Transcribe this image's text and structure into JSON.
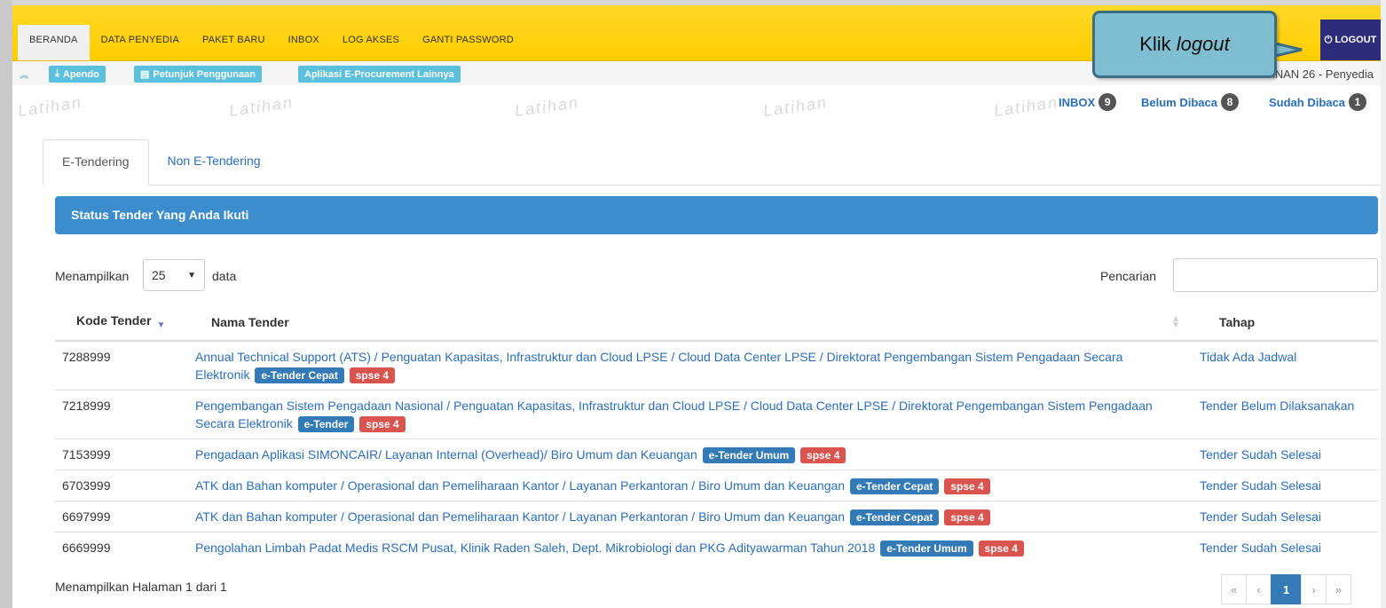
{
  "nav": {
    "items": [
      "BERANDA",
      "DATA PENYEDIA",
      "PAKET BARU",
      "INBOX",
      "LOG AKSES",
      "GANTI PASSWORD"
    ],
    "logout_label": "LOGOUT"
  },
  "callout": {
    "prefix": "Klik ",
    "emphasis": "logout"
  },
  "toolbar": {
    "apendo": "Apendo",
    "petunjuk": "Petunjuk Penggunaan",
    "aplikasi": "Aplikasi E-Procurement Lainnya",
    "user": "REKANAN 26 - Penyedia"
  },
  "watermark": "Latihan",
  "inbox": {
    "inbox_label": "INBOX",
    "inbox_count": "9",
    "unread_label": "Belum Dibaca",
    "unread_count": "8",
    "read_label": "Sudah Dibaca",
    "read_count": "1"
  },
  "tabs": [
    "E-Tendering",
    "Non E-Tendering"
  ],
  "panel": {
    "title": "Status Tender Yang Anda Ikuti"
  },
  "controls": {
    "show_label": "Menampilkan",
    "page_size": "25",
    "data_label": "data",
    "search_label": "Pencarian"
  },
  "table": {
    "headers": {
      "code": "Kode Tender",
      "name": "Nama Tender",
      "stage": "Tahap"
    },
    "rows": [
      {
        "code": "7288999",
        "name": "Annual Technical Support (ATS) / Penguatan Kapasitas, Infrastruktur dan Cloud LPSE / Cloud Data Center LPSE / Direktorat Pengembangan Sistem Pengadaan Secara Elektronik",
        "method": "e-Tender Cepat",
        "version": "spse 4",
        "stage": "Tidak Ada Jadwal"
      },
      {
        "code": "7218999",
        "name": "Pengembangan Sistem Pengadaan Nasional / Penguatan Kapasitas, Infrastruktur dan Cloud LPSE / Cloud Data Center LPSE / Direktorat Pengembangan Sistem Pengadaan Secara Elektronik",
        "method": "e-Tender",
        "version": "spse 4",
        "stage": "Tender Belum Dilaksanakan"
      },
      {
        "code": "7153999",
        "name": "Pengadaan Aplikasi SIMONCAIR/ Layanan Internal (Overhead)/ Biro Umum dan Keuangan",
        "method": "e-Tender Umum",
        "version": "spse 4",
        "stage": "Tender Sudah Selesai"
      },
      {
        "code": "6703999",
        "name": "ATK dan Bahan komputer / Operasional dan Pemeliharaan Kantor / Layanan Perkantoran / Biro Umum dan Keuangan",
        "method": "e-Tender Cepat",
        "version": "spse 4",
        "stage": "Tender Sudah Selesai"
      },
      {
        "code": "6697999",
        "name": "ATK dan Bahan komputer / Operasional dan Pemeliharaan Kantor / Layanan Perkantoran / Biro Umum dan Keuangan",
        "method": "e-Tender Cepat",
        "version": "spse 4",
        "stage": "Tender Sudah Selesai"
      },
      {
        "code": "6669999",
        "name": "Pengolahan Limbah Padat Medis RSCM Pusat, Klinik Raden Saleh, Dept. Mikrobiologi dan PKG Adityawarman Tahun 2018",
        "method": "e-Tender Umum",
        "version": "spse 4",
        "stage": "Tender Sudah Selesai"
      }
    ]
  },
  "footer": {
    "info": "Menampilkan Halaman 1 dari 1"
  },
  "pagination": {
    "first": "«",
    "prev": "‹",
    "current": "1",
    "next": "›",
    "last": "»"
  },
  "colors": {
    "nav_bg": "#ffcc00",
    "panel": "#3c8dcd",
    "link": "#2a6ebb",
    "label_blue": "#337ab7",
    "label_red": "#d9534f",
    "callout": "#7fbed1"
  }
}
